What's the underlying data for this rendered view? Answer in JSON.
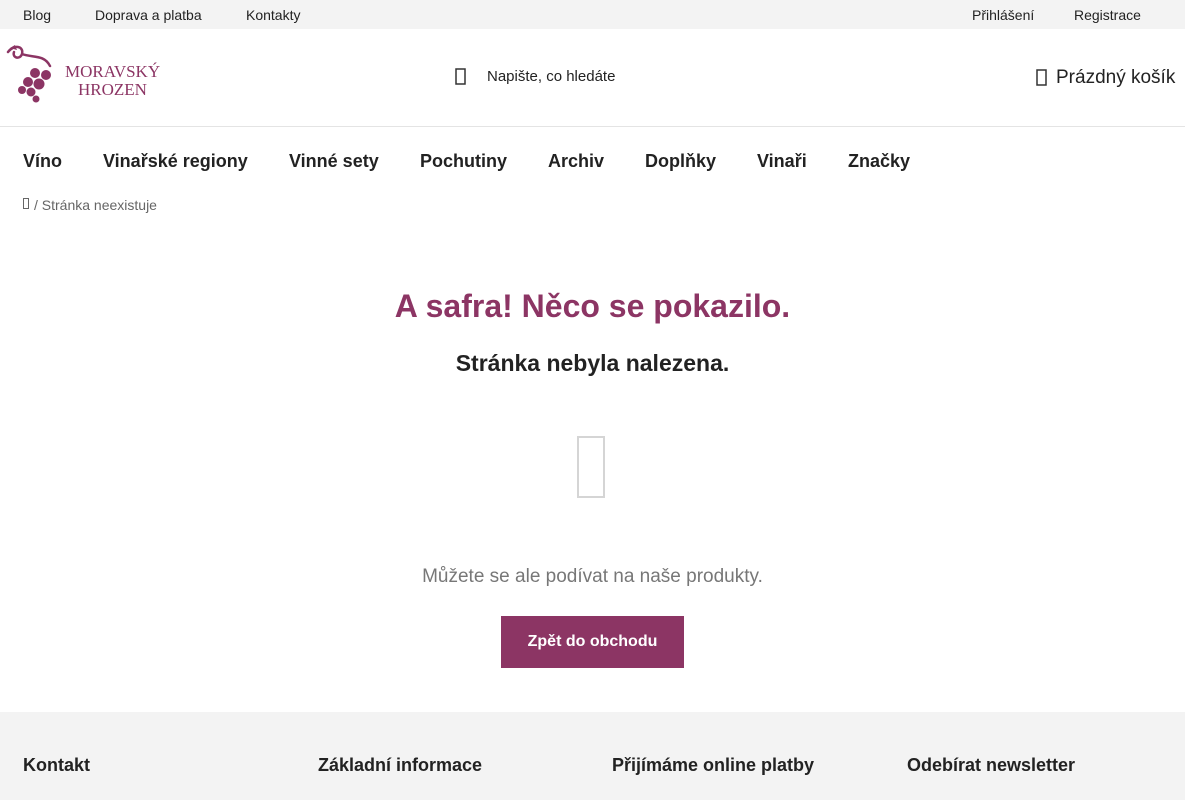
{
  "topbar": {
    "links": [
      "Blog",
      "Doprava a platba",
      "Kontakty"
    ],
    "login": "Přihlášení",
    "register": "Registrace"
  },
  "header": {
    "logo_icon": "grape-vine-logo",
    "logo_text_line1": "MORAVSKÝ",
    "logo_text_line2": "HROZEN",
    "search_icon": "search-icon",
    "search_placeholder": "Napište, co hledáte",
    "cart_icon": "cart-icon",
    "cart_label": "Prázdný košík"
  },
  "nav": {
    "items": [
      "Víno",
      "Vinařské regiony",
      "Vinné sety",
      "Pochutiny",
      "Archiv",
      "Doplňky",
      "Vinaři",
      "Značky"
    ]
  },
  "breadcrumb": {
    "home_icon": "home-icon",
    "separator": "/",
    "current": "Stránka neexistuje"
  },
  "content": {
    "title": "A safra! Něco se pokazilo.",
    "subtitle": "Stránka nebyla nalezena.",
    "icon": "missing-glyph-icon",
    "note": "Můžete se ale podívat na naše produkty.",
    "button": "Zpět do obchodu"
  },
  "footer": {
    "columns": [
      "Kontakt",
      "Základní informace",
      "Přijímáme online platby",
      "Odebírat newsletter"
    ]
  },
  "colors": {
    "accent": "#8c3564",
    "topbar_bg": "#f3f3f3",
    "footer_bg": "#f3f3f3"
  }
}
